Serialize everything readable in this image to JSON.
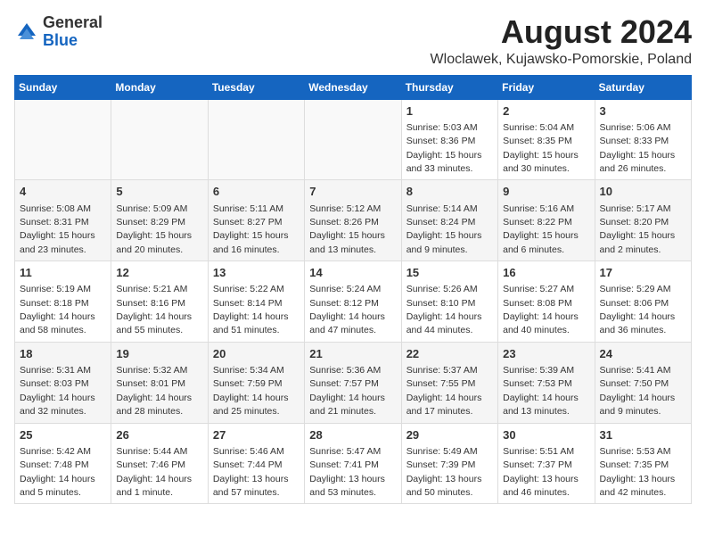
{
  "logo": {
    "general": "General",
    "blue": "Blue"
  },
  "title": "August 2024",
  "subtitle": "Wloclawek, Kujawsko-Pomorskie, Poland",
  "days_of_week": [
    "Sunday",
    "Monday",
    "Tuesday",
    "Wednesday",
    "Thursday",
    "Friday",
    "Saturday"
  ],
  "weeks": [
    [
      {
        "day": "",
        "info": ""
      },
      {
        "day": "",
        "info": ""
      },
      {
        "day": "",
        "info": ""
      },
      {
        "day": "",
        "info": ""
      },
      {
        "day": "1",
        "info": "Sunrise: 5:03 AM\nSunset: 8:36 PM\nDaylight: 15 hours\nand 33 minutes."
      },
      {
        "day": "2",
        "info": "Sunrise: 5:04 AM\nSunset: 8:35 PM\nDaylight: 15 hours\nand 30 minutes."
      },
      {
        "day": "3",
        "info": "Sunrise: 5:06 AM\nSunset: 8:33 PM\nDaylight: 15 hours\nand 26 minutes."
      }
    ],
    [
      {
        "day": "4",
        "info": "Sunrise: 5:08 AM\nSunset: 8:31 PM\nDaylight: 15 hours\nand 23 minutes."
      },
      {
        "day": "5",
        "info": "Sunrise: 5:09 AM\nSunset: 8:29 PM\nDaylight: 15 hours\nand 20 minutes."
      },
      {
        "day": "6",
        "info": "Sunrise: 5:11 AM\nSunset: 8:27 PM\nDaylight: 15 hours\nand 16 minutes."
      },
      {
        "day": "7",
        "info": "Sunrise: 5:12 AM\nSunset: 8:26 PM\nDaylight: 15 hours\nand 13 minutes."
      },
      {
        "day": "8",
        "info": "Sunrise: 5:14 AM\nSunset: 8:24 PM\nDaylight: 15 hours\nand 9 minutes."
      },
      {
        "day": "9",
        "info": "Sunrise: 5:16 AM\nSunset: 8:22 PM\nDaylight: 15 hours\nand 6 minutes."
      },
      {
        "day": "10",
        "info": "Sunrise: 5:17 AM\nSunset: 8:20 PM\nDaylight: 15 hours\nand 2 minutes."
      }
    ],
    [
      {
        "day": "11",
        "info": "Sunrise: 5:19 AM\nSunset: 8:18 PM\nDaylight: 14 hours\nand 58 minutes."
      },
      {
        "day": "12",
        "info": "Sunrise: 5:21 AM\nSunset: 8:16 PM\nDaylight: 14 hours\nand 55 minutes."
      },
      {
        "day": "13",
        "info": "Sunrise: 5:22 AM\nSunset: 8:14 PM\nDaylight: 14 hours\nand 51 minutes."
      },
      {
        "day": "14",
        "info": "Sunrise: 5:24 AM\nSunset: 8:12 PM\nDaylight: 14 hours\nand 47 minutes."
      },
      {
        "day": "15",
        "info": "Sunrise: 5:26 AM\nSunset: 8:10 PM\nDaylight: 14 hours\nand 44 minutes."
      },
      {
        "day": "16",
        "info": "Sunrise: 5:27 AM\nSunset: 8:08 PM\nDaylight: 14 hours\nand 40 minutes."
      },
      {
        "day": "17",
        "info": "Sunrise: 5:29 AM\nSunset: 8:06 PM\nDaylight: 14 hours\nand 36 minutes."
      }
    ],
    [
      {
        "day": "18",
        "info": "Sunrise: 5:31 AM\nSunset: 8:03 PM\nDaylight: 14 hours\nand 32 minutes."
      },
      {
        "day": "19",
        "info": "Sunrise: 5:32 AM\nSunset: 8:01 PM\nDaylight: 14 hours\nand 28 minutes."
      },
      {
        "day": "20",
        "info": "Sunrise: 5:34 AM\nSunset: 7:59 PM\nDaylight: 14 hours\nand 25 minutes."
      },
      {
        "day": "21",
        "info": "Sunrise: 5:36 AM\nSunset: 7:57 PM\nDaylight: 14 hours\nand 21 minutes."
      },
      {
        "day": "22",
        "info": "Sunrise: 5:37 AM\nSunset: 7:55 PM\nDaylight: 14 hours\nand 17 minutes."
      },
      {
        "day": "23",
        "info": "Sunrise: 5:39 AM\nSunset: 7:53 PM\nDaylight: 14 hours\nand 13 minutes."
      },
      {
        "day": "24",
        "info": "Sunrise: 5:41 AM\nSunset: 7:50 PM\nDaylight: 14 hours\nand 9 minutes."
      }
    ],
    [
      {
        "day": "25",
        "info": "Sunrise: 5:42 AM\nSunset: 7:48 PM\nDaylight: 14 hours\nand 5 minutes."
      },
      {
        "day": "26",
        "info": "Sunrise: 5:44 AM\nSunset: 7:46 PM\nDaylight: 14 hours\nand 1 minute."
      },
      {
        "day": "27",
        "info": "Sunrise: 5:46 AM\nSunset: 7:44 PM\nDaylight: 13 hours\nand 57 minutes."
      },
      {
        "day": "28",
        "info": "Sunrise: 5:47 AM\nSunset: 7:41 PM\nDaylight: 13 hours\nand 53 minutes."
      },
      {
        "day": "29",
        "info": "Sunrise: 5:49 AM\nSunset: 7:39 PM\nDaylight: 13 hours\nand 50 minutes."
      },
      {
        "day": "30",
        "info": "Sunrise: 5:51 AM\nSunset: 7:37 PM\nDaylight: 13 hours\nand 46 minutes."
      },
      {
        "day": "31",
        "info": "Sunrise: 5:53 AM\nSunset: 7:35 PM\nDaylight: 13 hours\nand 42 minutes."
      }
    ]
  ]
}
